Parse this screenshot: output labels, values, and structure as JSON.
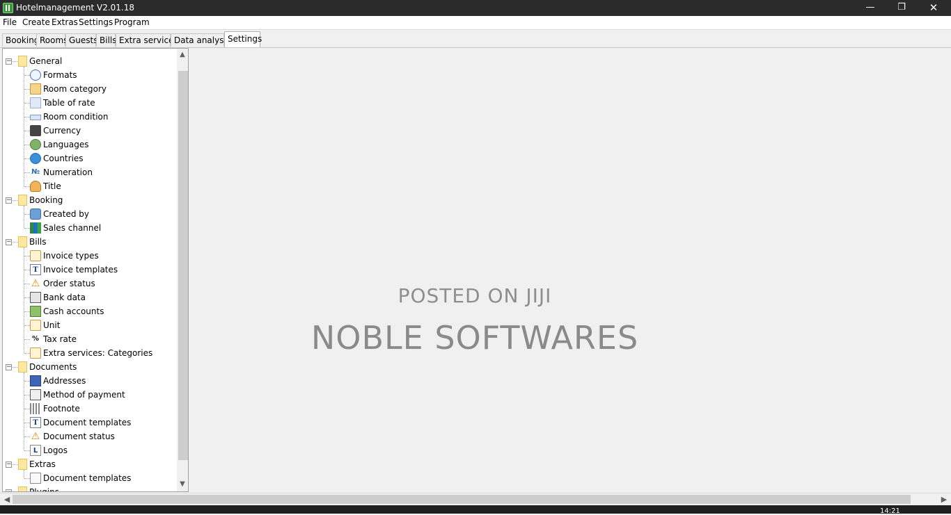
{
  "window": {
    "title": "Hotelmanagement V2.01.18",
    "minimize": "—",
    "maximize": "❐",
    "close": "✕"
  },
  "menu": [
    "File",
    "Create",
    "Extras",
    "Settings",
    "Program"
  ],
  "tabs": [
    {
      "label": "Booking",
      "active": false
    },
    {
      "label": "Rooms",
      "active": false
    },
    {
      "label": "Guests",
      "active": false
    },
    {
      "label": "Bills",
      "active": false
    },
    {
      "label": "Extra services",
      "active": false
    },
    {
      "label": "Data analyses",
      "active": false
    },
    {
      "label": "Settings",
      "active": true
    }
  ],
  "tree": {
    "groups": [
      {
        "label": "General",
        "expander": "−",
        "items": [
          {
            "label": "Formats",
            "icon": "clock-icon"
          },
          {
            "label": "Room category",
            "icon": "room-category-icon"
          },
          {
            "label": "Table of rate",
            "icon": "chart-icon"
          },
          {
            "label": "Room condition",
            "icon": "bed-icon"
          },
          {
            "label": "Currency",
            "icon": "currency-icon"
          },
          {
            "label": "Languages",
            "icon": "languages-icon"
          },
          {
            "label": "Countries",
            "icon": "globe-icon"
          },
          {
            "label": "Numeration",
            "icon": "numero-icon",
            "glyph": "№"
          },
          {
            "label": "Title",
            "icon": "person-icon"
          }
        ]
      },
      {
        "label": "Booking",
        "expander": "−",
        "items": [
          {
            "label": "Created by",
            "icon": "users-icon"
          },
          {
            "label": "Sales channel",
            "icon": "bar-chart-icon"
          }
        ]
      },
      {
        "label": "Bills",
        "expander": "−",
        "items": [
          {
            "label": "Invoice types",
            "icon": "document-icon"
          },
          {
            "label": "Invoice templates",
            "icon": "template-icon",
            "glyph": "T"
          },
          {
            "label": "Order status",
            "icon": "warning-icon"
          },
          {
            "label": "Bank data",
            "icon": "bank-icon"
          },
          {
            "label": "Cash accounts",
            "icon": "cash-icon"
          },
          {
            "label": "Unit",
            "icon": "document-icon"
          },
          {
            "label": "Tax rate",
            "icon": "percent-icon",
            "glyph": "%"
          },
          {
            "label": "Extra services: Categories",
            "icon": "document-icon"
          }
        ]
      },
      {
        "label": "Documents",
        "expander": "−",
        "items": [
          {
            "label": "Addresses",
            "icon": "address-book-icon"
          },
          {
            "label": "Method of payment",
            "icon": "payment-icon"
          },
          {
            "label": "Footnote",
            "icon": "footnote-icon"
          },
          {
            "label": "Document templates",
            "icon": "template-icon",
            "glyph": "T"
          },
          {
            "label": "Document status",
            "icon": "warning-icon"
          },
          {
            "label": "Logos",
            "icon": "logo-icon",
            "glyph": "L"
          }
        ]
      },
      {
        "label": "Extras",
        "expander": "−",
        "items": [
          {
            "label": "Document templates",
            "icon": "template-doc-icon"
          }
        ]
      },
      {
        "label": "Plugins",
        "expander": "−",
        "items": []
      }
    ]
  },
  "watermark": {
    "line1": "POSTED ON JIJI",
    "line2": "NOBLE SOFTWARES"
  },
  "taskbar": {
    "clock": "14:21"
  },
  "colors": {
    "titlebar": "#2b2b2b",
    "background": "#f0f0f0",
    "tree_background": "#ffffff",
    "folder": "#ffe8a3"
  }
}
